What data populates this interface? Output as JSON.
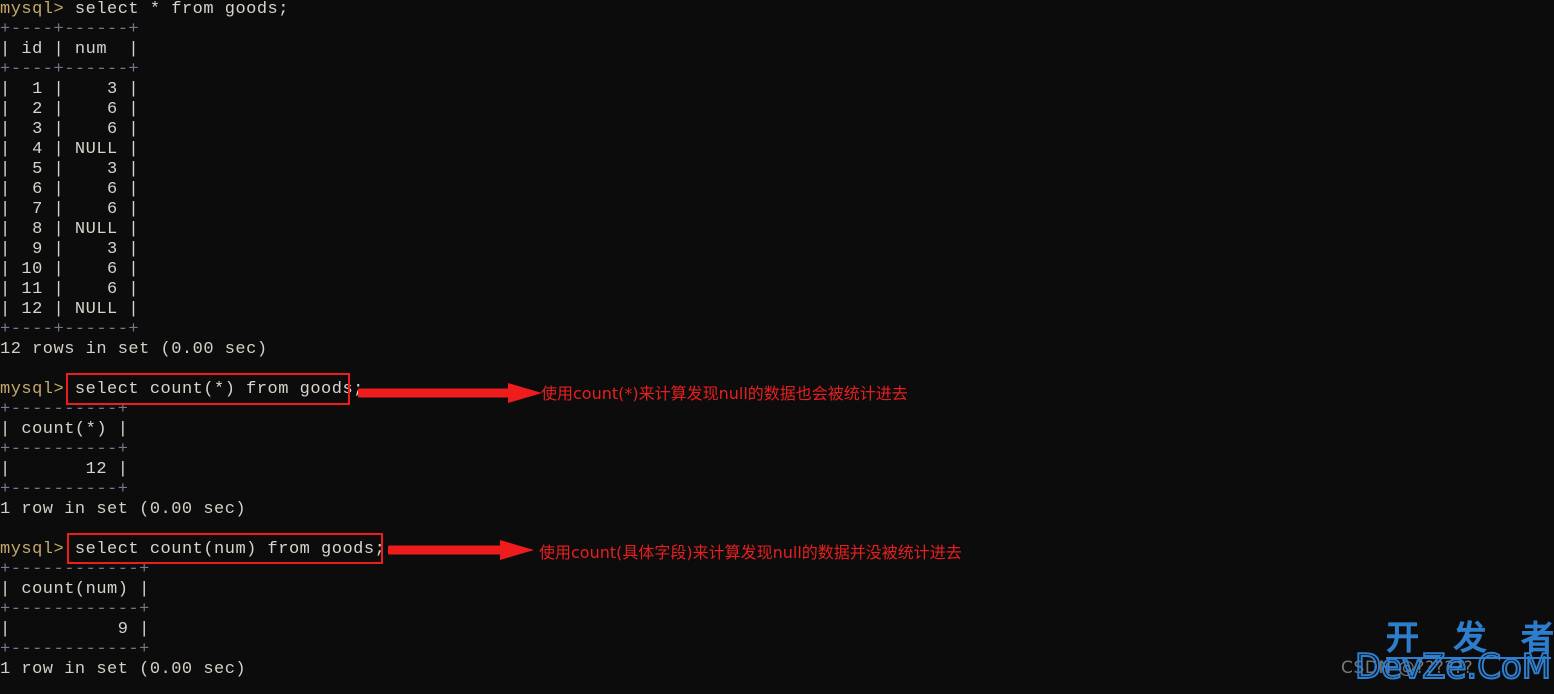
{
  "terminal": {
    "lines": [
      {
        "kind": "command",
        "prompt": "mysql> ",
        "text": "select * from goods;"
      },
      {
        "kind": "rule",
        "text": "+----+------+"
      },
      {
        "kind": "header",
        "text": "| id | num  |"
      },
      {
        "kind": "rule",
        "text": "+----+------+"
      },
      {
        "kind": "row",
        "text": "|  1 |    3 |"
      },
      {
        "kind": "row",
        "text": "|  2 |    6 |"
      },
      {
        "kind": "row",
        "text": "|  3 |    6 |"
      },
      {
        "kind": "row",
        "text": "|  4 | NULL |"
      },
      {
        "kind": "row",
        "text": "|  5 |    3 |"
      },
      {
        "kind": "row",
        "text": "|  6 |    6 |"
      },
      {
        "kind": "row",
        "text": "|  7 |    6 |"
      },
      {
        "kind": "row",
        "text": "|  8 | NULL |"
      },
      {
        "kind": "row",
        "text": "|  9 |    3 |"
      },
      {
        "kind": "row",
        "text": "| 10 |    6 |"
      },
      {
        "kind": "row",
        "text": "| 11 |    6 |"
      },
      {
        "kind": "row",
        "text": "| 12 | NULL |"
      },
      {
        "kind": "rule",
        "text": "+----+------+"
      },
      {
        "kind": "status",
        "text": "12 rows in set (0.00 sec)"
      },
      {
        "kind": "blank",
        "text": " "
      },
      {
        "kind": "command",
        "prompt": "mysql> ",
        "text": "select count(*) from goods;"
      },
      {
        "kind": "rule",
        "text": "+----------+"
      },
      {
        "kind": "header",
        "text": "| count(*) |"
      },
      {
        "kind": "rule",
        "text": "+----------+"
      },
      {
        "kind": "row",
        "text": "|       12 |"
      },
      {
        "kind": "rule",
        "text": "+----------+"
      },
      {
        "kind": "status",
        "text": "1 row in set (0.00 sec)"
      },
      {
        "kind": "blank",
        "text": " "
      },
      {
        "kind": "command",
        "prompt": "mysql> ",
        "text": "select count(num) from goods;"
      },
      {
        "kind": "rule",
        "text": "+------------+"
      },
      {
        "kind": "header",
        "text": "| count(num) |"
      },
      {
        "kind": "rule",
        "text": "+------------+"
      },
      {
        "kind": "row",
        "text": "|          9 |"
      },
      {
        "kind": "rule",
        "text": "+------------+"
      },
      {
        "kind": "status",
        "text": "1 row in set (0.00 sec)"
      }
    ]
  },
  "annotations": {
    "color": "#ee1c1c",
    "first": {
      "highlighted_sql": "select count(*) from goods;",
      "note": "使用count(*)来计算发现null的数据也会被统计进去"
    },
    "second": {
      "highlighted_sql": "select count(num) from goods;",
      "note": "使用count(具体字段)来计算发现null的数据并没被统计进去"
    }
  },
  "watermark": {
    "csdn": "CSDN @??????",
    "chinese": "开 发 者",
    "site": "DevZe.CoM",
    "color": "#2f7fd0"
  }
}
